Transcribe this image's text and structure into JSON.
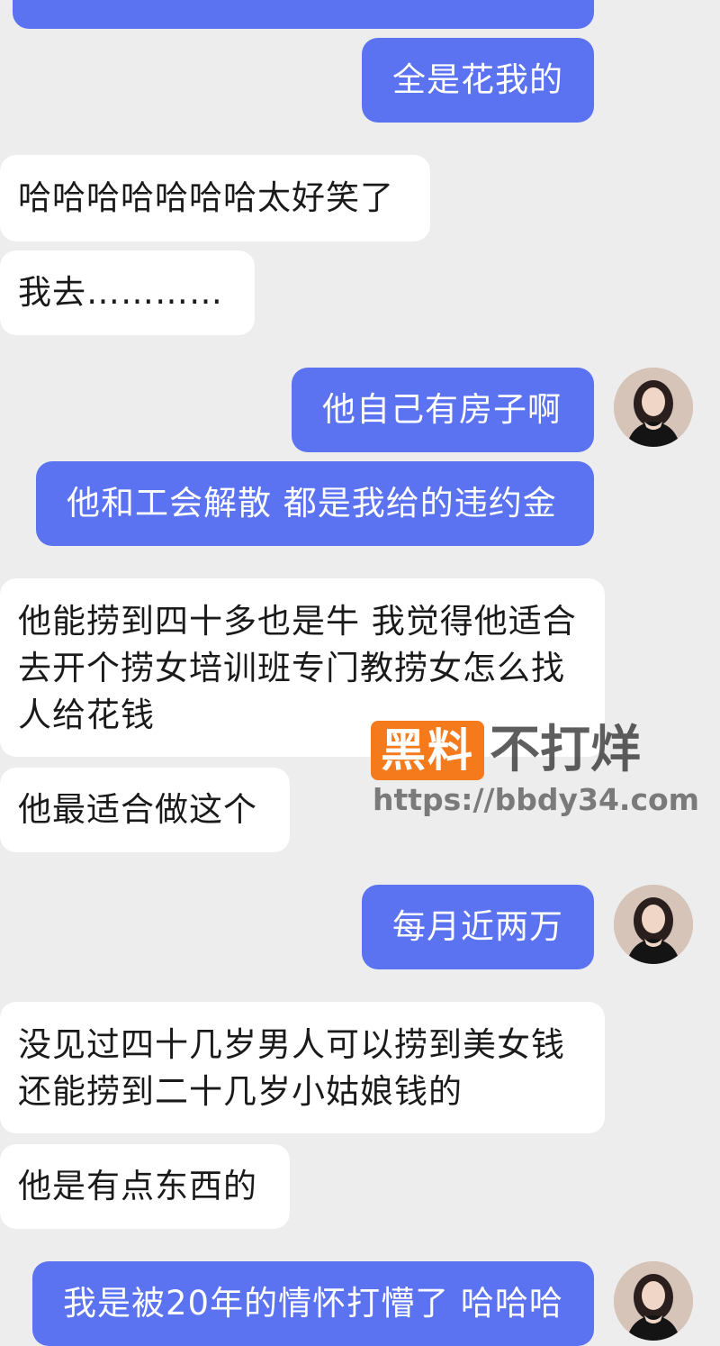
{
  "messages": [
    {
      "direction": "out",
      "text": "全是花我的"
    },
    {
      "direction": "in",
      "text": "哈哈哈哈哈哈哈太好笑了"
    },
    {
      "direction": "in",
      "text": "我去…………"
    },
    {
      "direction": "out",
      "text": "他自己有房子啊"
    },
    {
      "direction": "out",
      "text": "他和工会解散 都是我给的违约金"
    },
    {
      "direction": "in",
      "text": "他能捞到四十多也是牛 我觉得他适合去开个捞女培训班专门教捞女怎么找人给花钱"
    },
    {
      "direction": "in",
      "text": "他最适合做这个"
    },
    {
      "direction": "out",
      "text": "每月近两万"
    },
    {
      "direction": "in",
      "text": "没见过四十几岁男人可以捞到美女钱还能捞到二十几岁小姑娘钱的"
    },
    {
      "direction": "in",
      "text": "他是有点东西的"
    },
    {
      "direction": "out",
      "text": "我是被20年的情怀打懵了 哈哈哈"
    }
  ],
  "watermark": {
    "badge": "黑料",
    "text": "不打烊",
    "url": "https://bbdy34.com"
  },
  "colors": {
    "background": "#ededed",
    "outgoing_bubble": "#5b73f0",
    "incoming_bubble": "#ffffff",
    "watermark_badge": "#f47a1c"
  }
}
